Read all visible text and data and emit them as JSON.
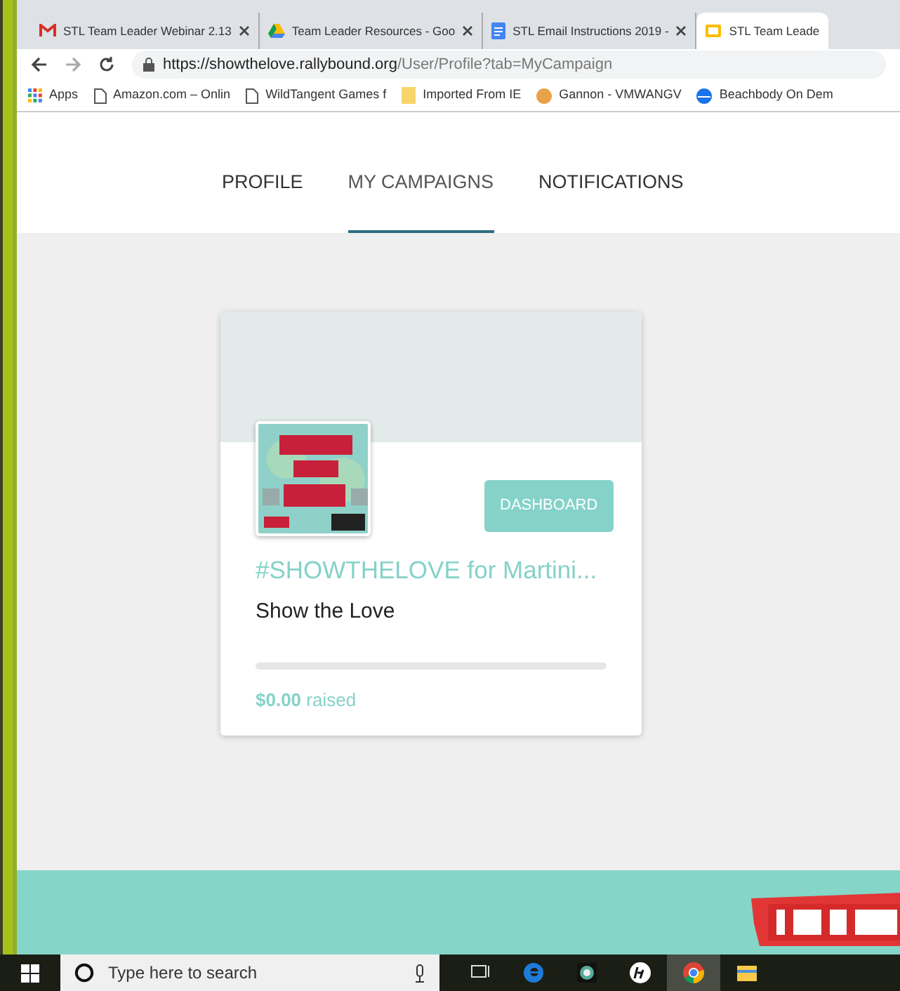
{
  "browser": {
    "tabs": [
      {
        "title": "STL Team Leader Webinar 2.13",
        "selected": false
      },
      {
        "title": "Team Leader Resources - Goo",
        "selected": false
      },
      {
        "title": "STL Email Instructions 2019 -",
        "selected": false
      },
      {
        "title": "STL Team Leade",
        "selected": true
      }
    ],
    "url": {
      "origin": "https://showthelove.rallybound.org",
      "path": "/User/Profile?tab=MyCampaign"
    },
    "bookmarks": [
      "Apps",
      "Amazon.com – Onlin",
      "WildTangent Games f",
      "Imported From IE",
      "Gannon - VMWANGV",
      "Beachbody On Dem"
    ]
  },
  "nav": [
    {
      "label": "PROFILE",
      "selected": false
    },
    {
      "label": "MY CAMPAIGNS",
      "selected": true
    },
    {
      "label": "NOTIFICATIONS",
      "selected": false
    }
  ],
  "campaign": {
    "button": "DASHBOARD",
    "title": "#SHOWTHELOVE for Martini...",
    "subtitle": "Show the Love",
    "level": 0,
    "amount": "$0.00",
    "amount_label": "raised"
  },
  "taskbar": {
    "search_placeholder": "Type here to search",
    "apps": [
      {
        "kind": "taskview",
        "selected": false
      },
      {
        "kind": "edge",
        "selected": false
      },
      {
        "kind": "camera",
        "selected": false
      },
      {
        "kind": "hp",
        "selected": false
      },
      {
        "kind": "chrome",
        "selected": true
      },
      {
        "kind": "explorer",
        "selected": false
      }
    ]
  }
}
